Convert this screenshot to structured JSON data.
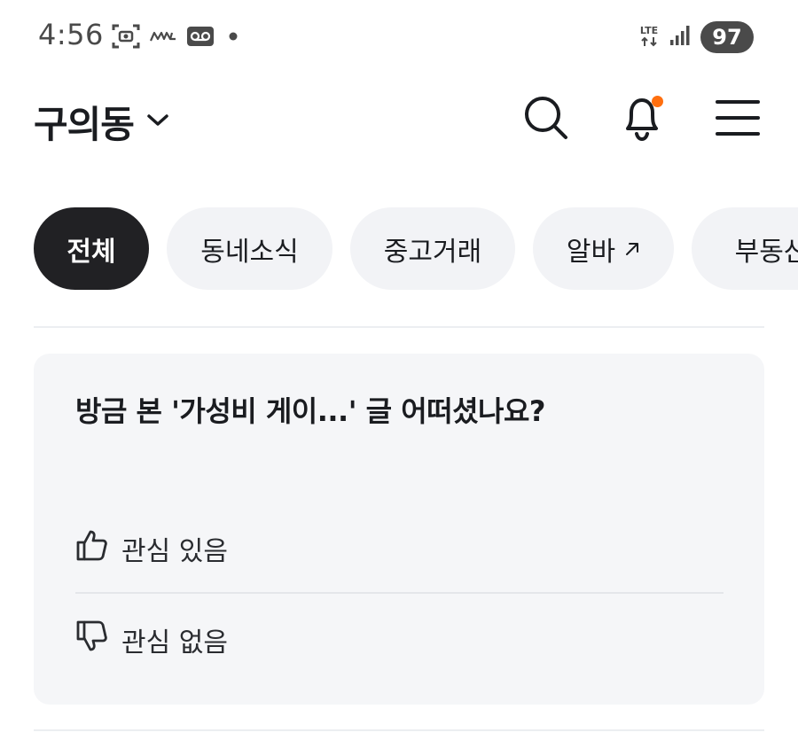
{
  "status_bar": {
    "time": "4:56",
    "network": "LTE",
    "battery": "97"
  },
  "header": {
    "location": "구의동",
    "icons": [
      "chevron-down-icon",
      "search-icon",
      "bell-icon",
      "menu-icon"
    ],
    "notification_dot_color": "#ff6f0f"
  },
  "categories": [
    {
      "label": "전체",
      "active": true
    },
    {
      "label": "동네소식",
      "active": false
    },
    {
      "label": "중고거래",
      "active": false
    },
    {
      "label": "알바",
      "active": false,
      "external": true
    },
    {
      "label": "부동산",
      "active": false
    }
  ],
  "feedback": {
    "question": "방금 본 '가성비 게이...' 글 어떠셨나요?",
    "interested_label": "관심 있음",
    "not_interested_label": "관심 없음"
  },
  "colors": {
    "accent": "#ff6f0f",
    "chip_active_bg": "#212124",
    "chip_bg": "#f2f3f6",
    "card_bg": "#f5f6f8"
  }
}
